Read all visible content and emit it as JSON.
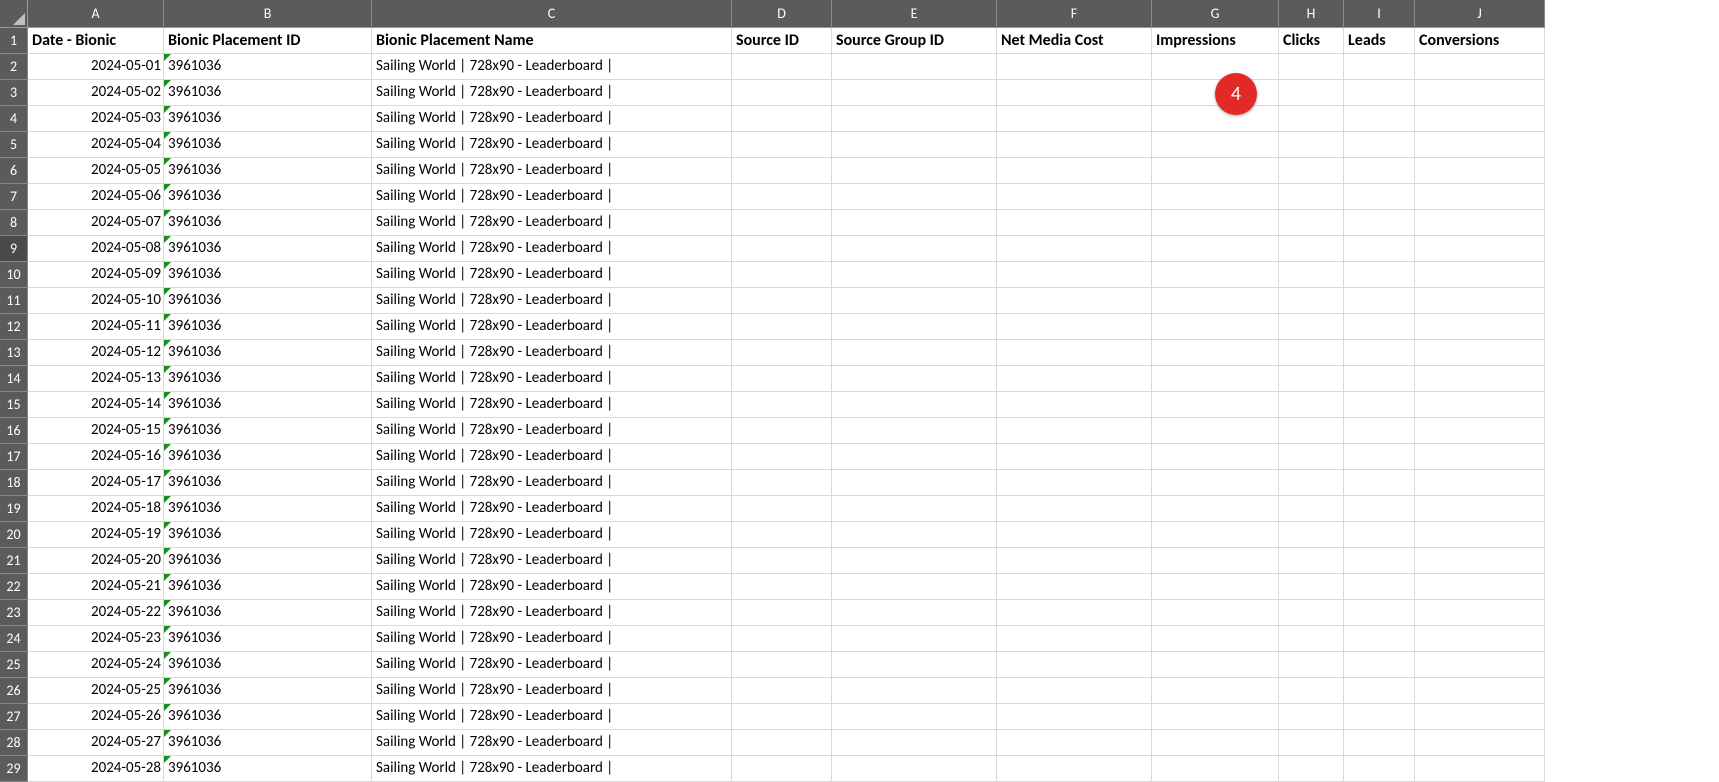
{
  "annotation_badge": "4",
  "col_letters": [
    "A",
    "B",
    "C",
    "D",
    "E",
    "F",
    "G",
    "H",
    "I",
    "J"
  ],
  "headers": {
    "A": "Date - Bionic",
    "B": "Bionic Placement ID",
    "C": "Bionic Placement Name",
    "D": "Source ID",
    "E": "Source Group ID",
    "F": "Net Media Cost",
    "G": "Impressions",
    "H": "Clicks",
    "I": "Leads",
    "J": "Conversions"
  },
  "rows": [
    {
      "n": 2,
      "date": "2024-05-01",
      "pid": "3961036",
      "pname": "Sailing World | 728x90 - Leaderboard |"
    },
    {
      "n": 3,
      "date": "2024-05-02",
      "pid": "3961036",
      "pname": "Sailing World | 728x90 - Leaderboard |"
    },
    {
      "n": 4,
      "date": "2024-05-03",
      "pid": "3961036",
      "pname": "Sailing World | 728x90 - Leaderboard |"
    },
    {
      "n": 5,
      "date": "2024-05-04",
      "pid": "3961036",
      "pname": "Sailing World | 728x90 - Leaderboard |"
    },
    {
      "n": 6,
      "date": "2024-05-05",
      "pid": "3961036",
      "pname": "Sailing World | 728x90 - Leaderboard |"
    },
    {
      "n": 7,
      "date": "2024-05-06",
      "pid": "3961036",
      "pname": "Sailing World | 728x90 - Leaderboard |"
    },
    {
      "n": 8,
      "date": "2024-05-07",
      "pid": "3961036",
      "pname": "Sailing World | 728x90 - Leaderboard |"
    },
    {
      "n": 9,
      "date": "2024-05-08",
      "pid": "3961036",
      "pname": "Sailing World | 728x90 - Leaderboard |"
    },
    {
      "n": 10,
      "date": "2024-05-09",
      "pid": "3961036",
      "pname": "Sailing World | 728x90 - Leaderboard |"
    },
    {
      "n": 11,
      "date": "2024-05-10",
      "pid": "3961036",
      "pname": "Sailing World | 728x90 - Leaderboard |"
    },
    {
      "n": 12,
      "date": "2024-05-11",
      "pid": "3961036",
      "pname": "Sailing World | 728x90 - Leaderboard |"
    },
    {
      "n": 13,
      "date": "2024-05-12",
      "pid": "3961036",
      "pname": "Sailing World | 728x90 - Leaderboard |"
    },
    {
      "n": 14,
      "date": "2024-05-13",
      "pid": "3961036",
      "pname": "Sailing World | 728x90 - Leaderboard |"
    },
    {
      "n": 15,
      "date": "2024-05-14",
      "pid": "3961036",
      "pname": "Sailing World | 728x90 - Leaderboard |"
    },
    {
      "n": 16,
      "date": "2024-05-15",
      "pid": "3961036",
      "pname": "Sailing World | 728x90 - Leaderboard |"
    },
    {
      "n": 17,
      "date": "2024-05-16",
      "pid": "3961036",
      "pname": "Sailing World | 728x90 - Leaderboard |"
    },
    {
      "n": 18,
      "date": "2024-05-17",
      "pid": "3961036",
      "pname": "Sailing World | 728x90 - Leaderboard |"
    },
    {
      "n": 19,
      "date": "2024-05-18",
      "pid": "3961036",
      "pname": "Sailing World | 728x90 - Leaderboard |"
    },
    {
      "n": 20,
      "date": "2024-05-19",
      "pid": "3961036",
      "pname": "Sailing World | 728x90 - Leaderboard |"
    },
    {
      "n": 21,
      "date": "2024-05-20",
      "pid": "3961036",
      "pname": "Sailing World | 728x90 - Leaderboard |"
    },
    {
      "n": 22,
      "date": "2024-05-21",
      "pid": "3961036",
      "pname": "Sailing World | 728x90 - Leaderboard |"
    },
    {
      "n": 23,
      "date": "2024-05-22",
      "pid": "3961036",
      "pname": "Sailing World | 728x90 - Leaderboard |"
    },
    {
      "n": 24,
      "date": "2024-05-23",
      "pid": "3961036",
      "pname": "Sailing World | 728x90 - Leaderboard |"
    },
    {
      "n": 25,
      "date": "2024-05-24",
      "pid": "3961036",
      "pname": "Sailing World | 728x90 - Leaderboard |"
    },
    {
      "n": 26,
      "date": "2024-05-25",
      "pid": "3961036",
      "pname": "Sailing World | 728x90 - Leaderboard |"
    },
    {
      "n": 27,
      "date": "2024-05-26",
      "pid": "3961036",
      "pname": "Sailing World | 728x90 - Leaderboard |"
    },
    {
      "n": 28,
      "date": "2024-05-27",
      "pid": "3961036",
      "pname": "Sailing World | 728x90 - Leaderboard |"
    },
    {
      "n": 29,
      "date": "2024-05-28",
      "pid": "3961036",
      "pname": "Sailing World | 728x90 - Leaderboard |"
    }
  ],
  "selected_row": 9
}
